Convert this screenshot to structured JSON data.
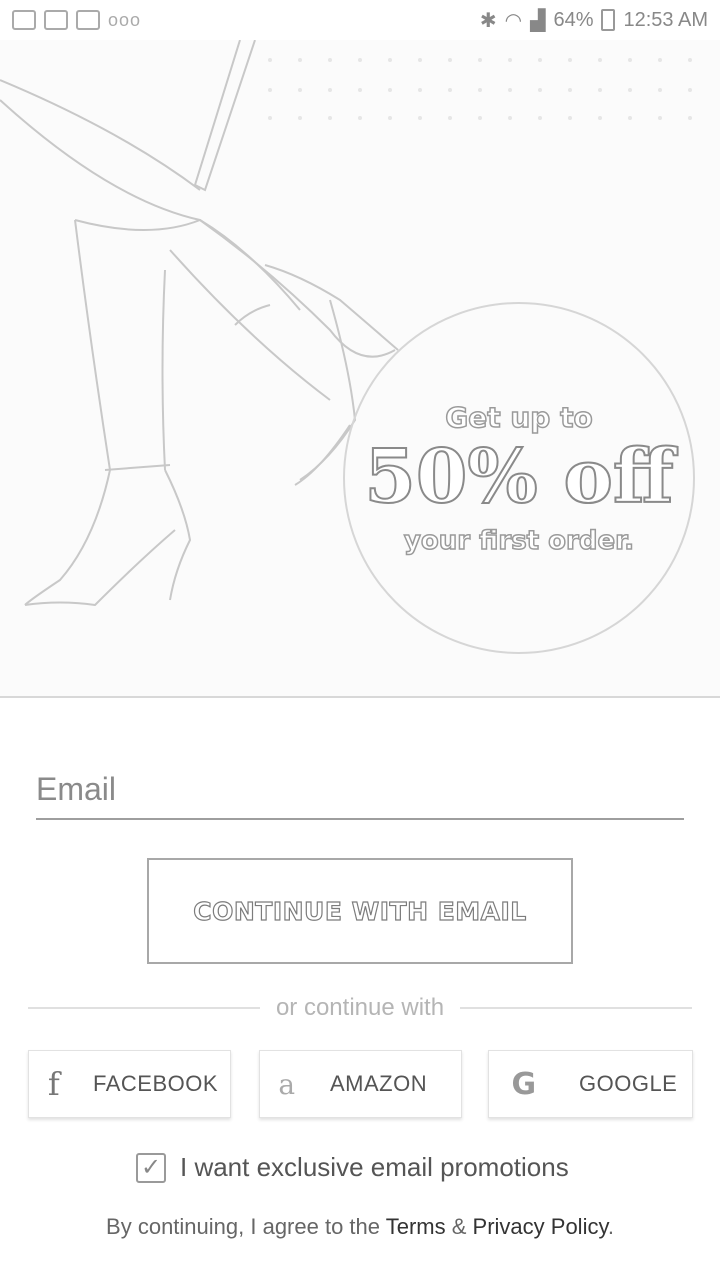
{
  "status_bar": {
    "notifications": [
      "settings-icon",
      "mail-icon",
      "picture-icon"
    ],
    "dots": "ooo",
    "battery": "64%",
    "time": "12:53 AM"
  },
  "hero": {
    "promo_top": "Get up to",
    "promo_big": "50% off",
    "promo_bottom": "your first order."
  },
  "form": {
    "email_placeholder": "Email",
    "continue_label": "CONTINUE WITH EMAIL",
    "divider_text": "or continue with"
  },
  "social": {
    "facebook": {
      "label": "FACEBOOK",
      "icon": "f"
    },
    "amazon": {
      "label": "AMAZON",
      "icon": "a"
    },
    "google": {
      "label": "GOOGLE",
      "icon": "G"
    }
  },
  "promotions": {
    "label": "I want exclusive email promotions",
    "checked": true
  },
  "terms": {
    "prefix": "By continuing, I agree to the ",
    "terms_link": "Terms",
    "amp": " & ",
    "privacy_link": "Privacy Policy",
    "suffix": "."
  }
}
